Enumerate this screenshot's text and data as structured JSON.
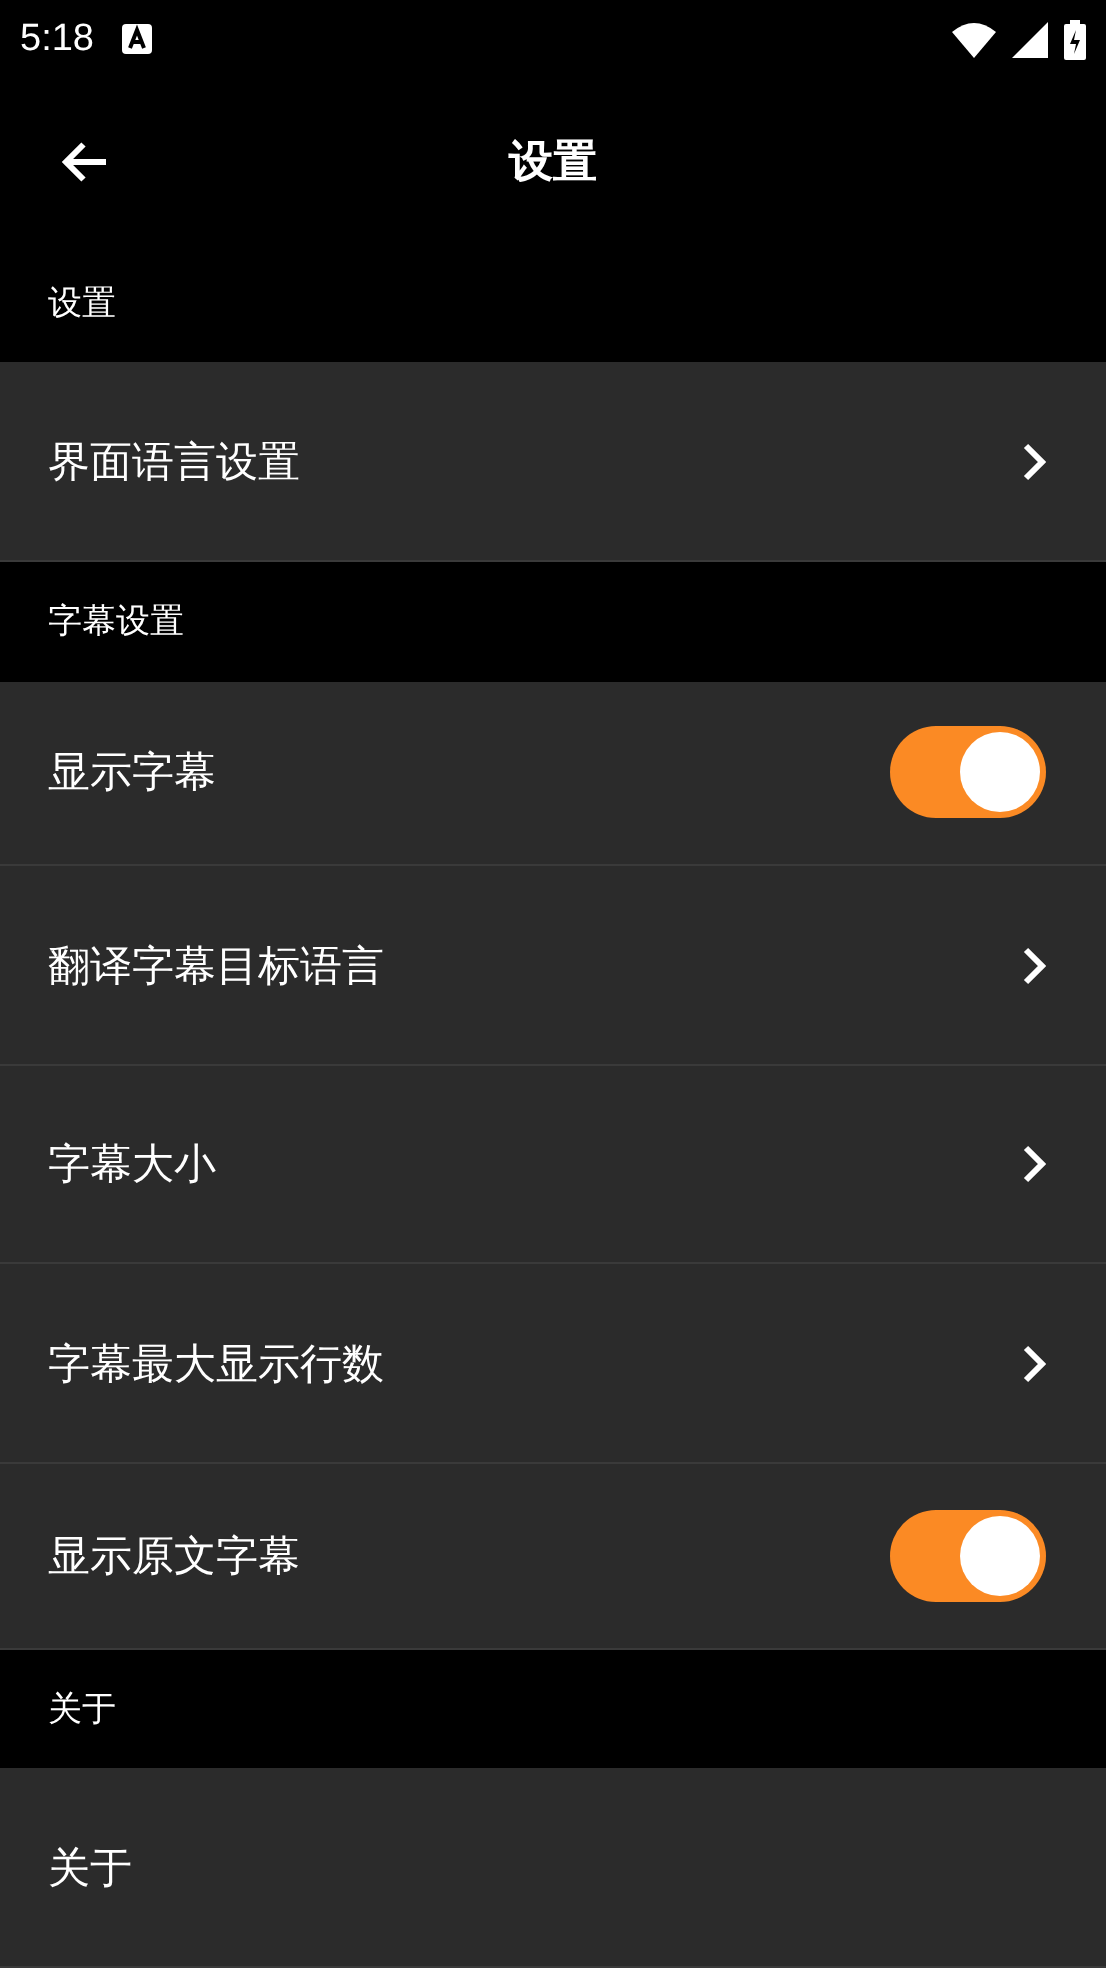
{
  "status_bar": {
    "time": "5:18"
  },
  "header": {
    "title": "设置"
  },
  "sections": [
    {
      "title": "设置",
      "items": [
        {
          "kind": "link",
          "label": "界面语言设置"
        }
      ]
    },
    {
      "title": "字幕设置",
      "items": [
        {
          "kind": "toggle",
          "label": "显示字幕",
          "on": true
        },
        {
          "kind": "link",
          "label": "翻译字幕目标语言"
        },
        {
          "kind": "link",
          "label": "字幕大小"
        },
        {
          "kind": "link",
          "label": "字幕最大显示行数"
        },
        {
          "kind": "toggle",
          "label": "显示原文字幕",
          "on": true
        }
      ]
    },
    {
      "title": "关于",
      "items": [
        {
          "kind": "plain",
          "label": "关于"
        }
      ]
    }
  ]
}
